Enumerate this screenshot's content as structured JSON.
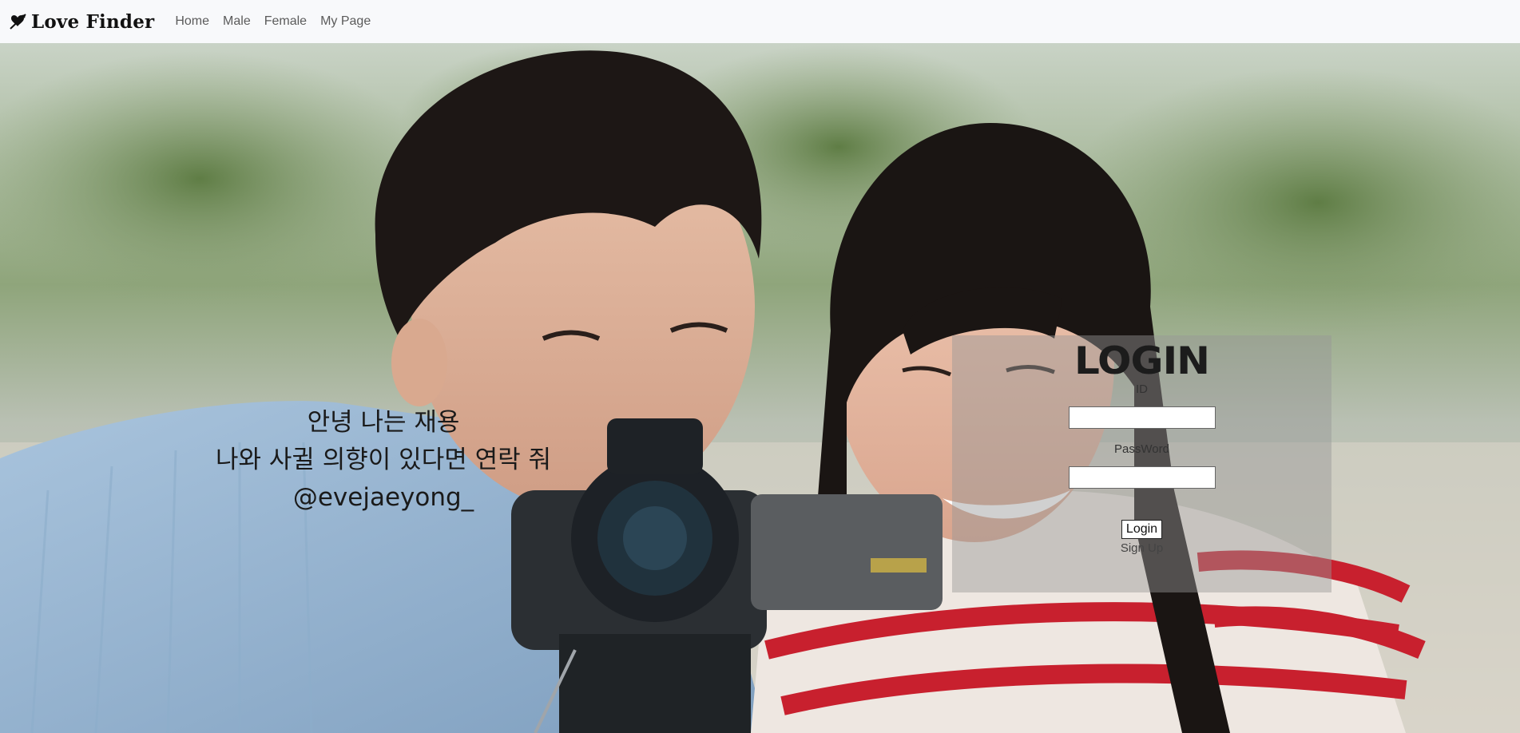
{
  "nav": {
    "brand": "Love Finder",
    "brand_icon": "cupid-heart-icon",
    "links": [
      "Home",
      "Male",
      "Female",
      "My Page"
    ]
  },
  "hero": {
    "greeting_lines": [
      "안녕 나는 재용",
      "나와 사귈 의향이 있다면 연락 줘",
      "@evejaeyong_"
    ]
  },
  "login": {
    "title": "LOGIN",
    "id_label": "ID",
    "password_label": "PassWord",
    "id_value": "",
    "password_value": "",
    "button": "Login",
    "signup": "Sign Up"
  },
  "colors": {
    "navbar_bg": "#f8f9fb",
    "panel_bg": "rgba(150,150,150,0.45)",
    "stripe_red": "#c8202e"
  }
}
